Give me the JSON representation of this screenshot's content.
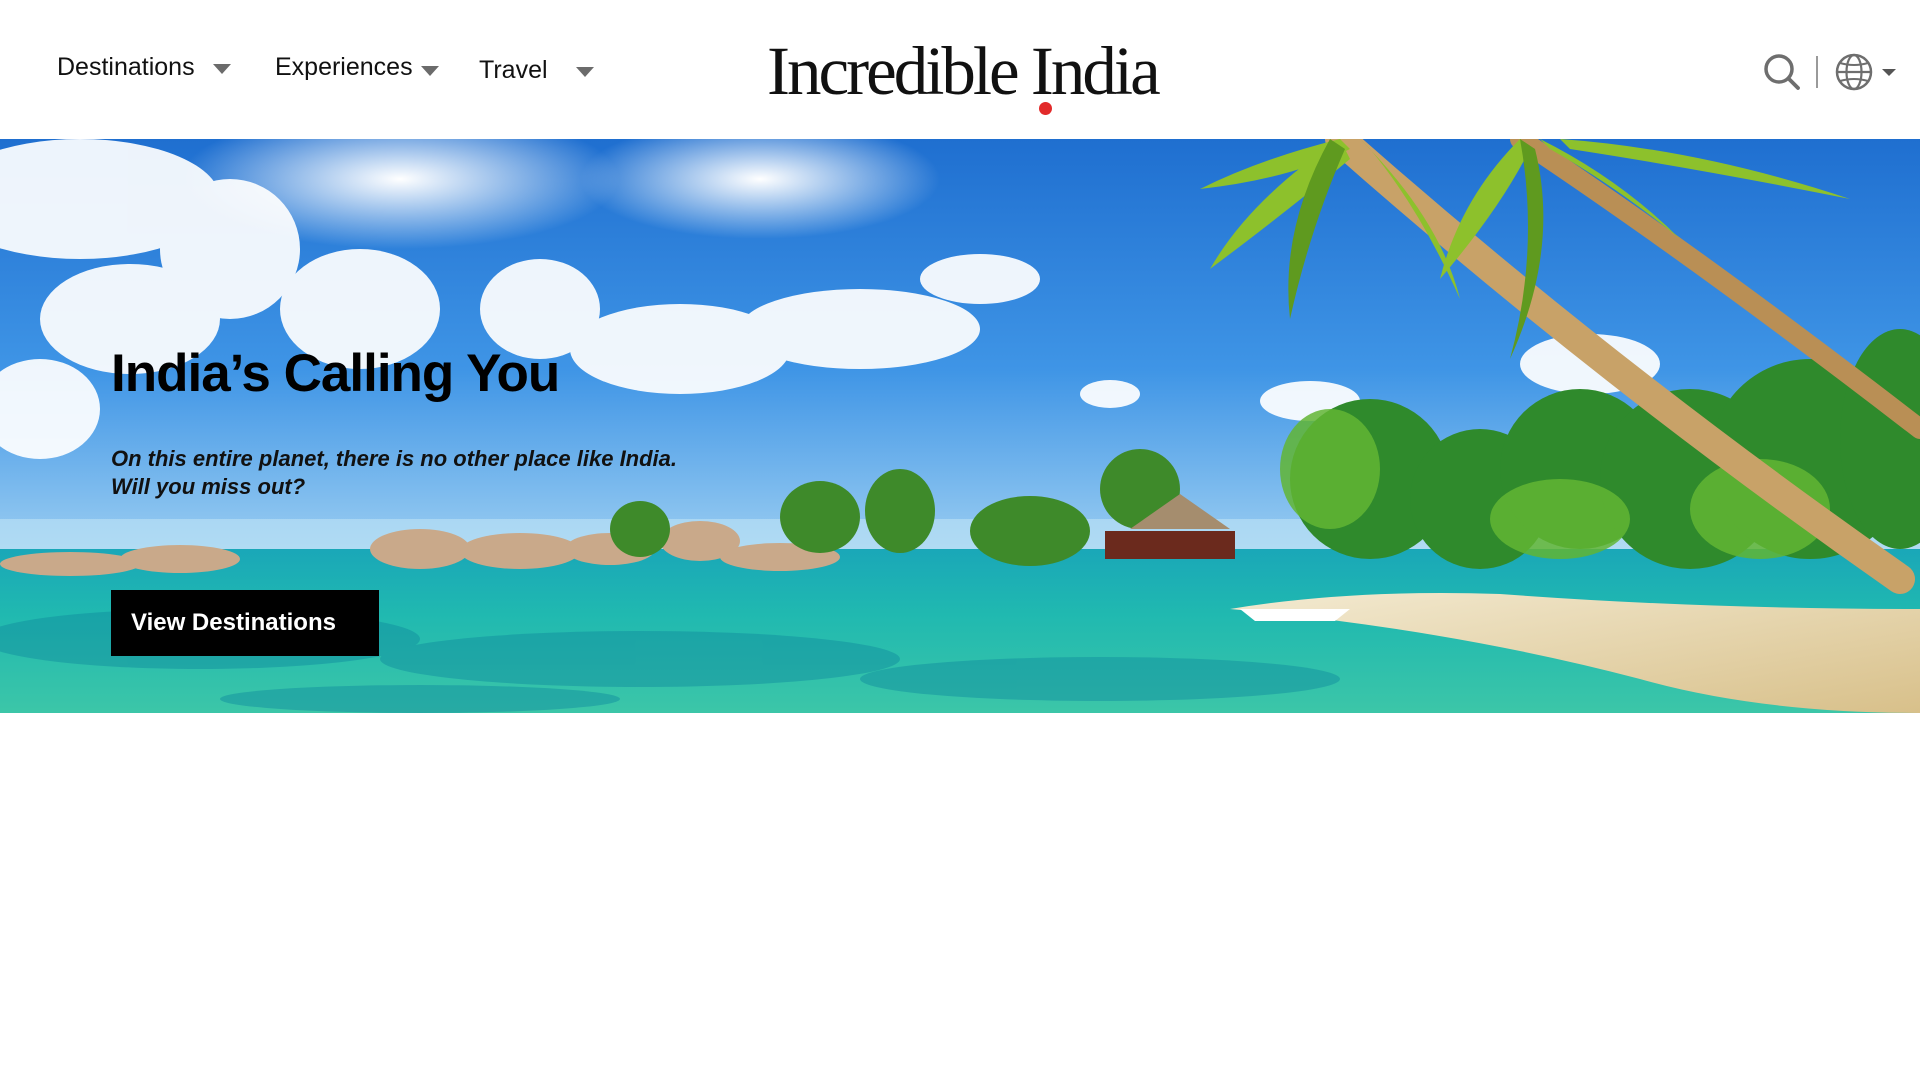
{
  "header": {
    "nav": [
      {
        "label": "Destinations",
        "icon": "chevron-down-icon"
      },
      {
        "label": "Experiences",
        "icon": "chevron-down-icon"
      },
      {
        "label": "Travel",
        "icon": "chevron-down-icon"
      }
    ],
    "logo_text": "Incredible India",
    "logo_accent_color": "#e22a2a",
    "tools": {
      "search_icon": "search-icon",
      "language_icon": "globe-icon"
    }
  },
  "hero": {
    "title": "India’s Calling You",
    "subtitle_line1": "On this entire planet, there is no other place like India.",
    "subtitle_line2": "Will you miss out?",
    "cta_label": "View Destinations",
    "image_description_icon": "tropical-beach-image"
  },
  "colors": {
    "cta_background": "#000000",
    "cta_text": "#ffffff",
    "page_background": "#ffffff"
  }
}
